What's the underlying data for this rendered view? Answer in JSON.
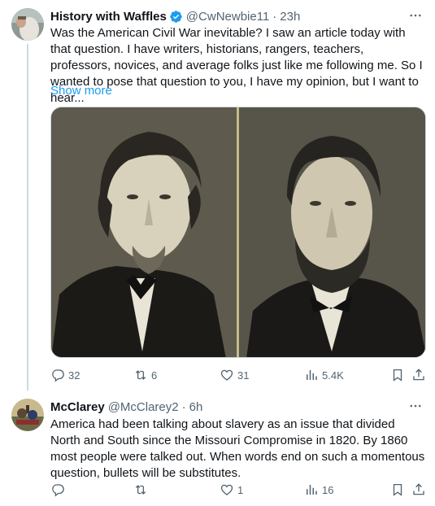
{
  "tweets": [
    {
      "author_name": "History with Waffles",
      "handle": "@CwNewbie11",
      "time": "23h",
      "text": "Was the American Civil War inevitable? I saw an article today with that question. I have writers, historians, rangers, teachers, professors, novices, and average folks just like me following me. So I wanted to pose that question to you, I have my opinion, but I want to hear...",
      "show_more": "Show more",
      "replies": "32",
      "reposts": "6",
      "likes": "31",
      "views": "5.4K"
    },
    {
      "author_name": "McClarey",
      "handle": "@McClarey2",
      "time": "6h",
      "text": "America had been talking about slavery as an issue that divided North and South since the Missouri Compromise in 1820.  By 1860 most people were talked out.  When words end on such a momentous question, bullets will be substitutes.",
      "replies": "",
      "reposts": "",
      "likes": "1",
      "views": "16"
    }
  ],
  "colors": {
    "text": "#0f1419",
    "secondary": "#536471",
    "link": "#1d9bf0",
    "verified": "#1d9bf0",
    "thread_line": "#cfd9de"
  }
}
